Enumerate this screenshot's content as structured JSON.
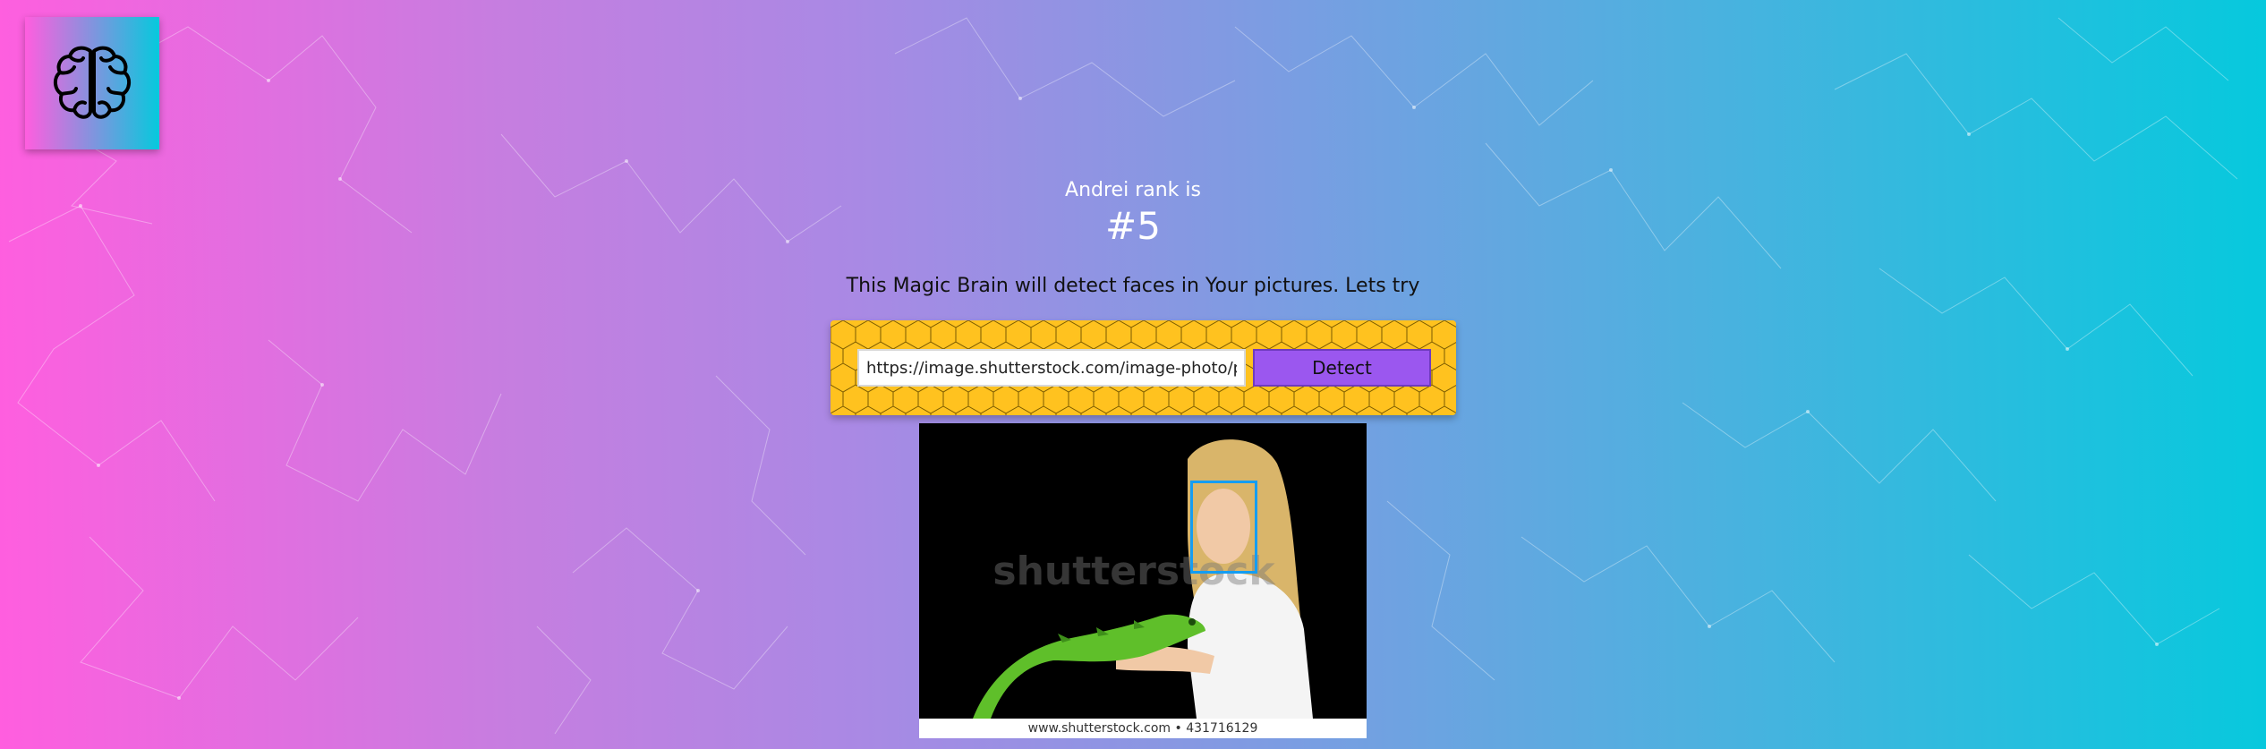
{
  "app": {
    "logo_icon": "brain-icon"
  },
  "rank": {
    "label": "Andrei rank is",
    "value": "#5"
  },
  "intro": {
    "text": "This Magic Brain will detect faces in Your pictures. Lets try"
  },
  "form": {
    "url_value": "https://image.shutterstock.com/image-photo/pr",
    "detect_label": "Detect"
  },
  "result": {
    "caption": "www.shutterstock.com • 431716129",
    "watermark": "shutterstock",
    "face_box_color": "#149df2"
  },
  "colors": {
    "gradient_left": "#ff5edf",
    "gradient_right": "#06c9dd",
    "panel": "#ffc21f",
    "button": "#9b57ef"
  }
}
